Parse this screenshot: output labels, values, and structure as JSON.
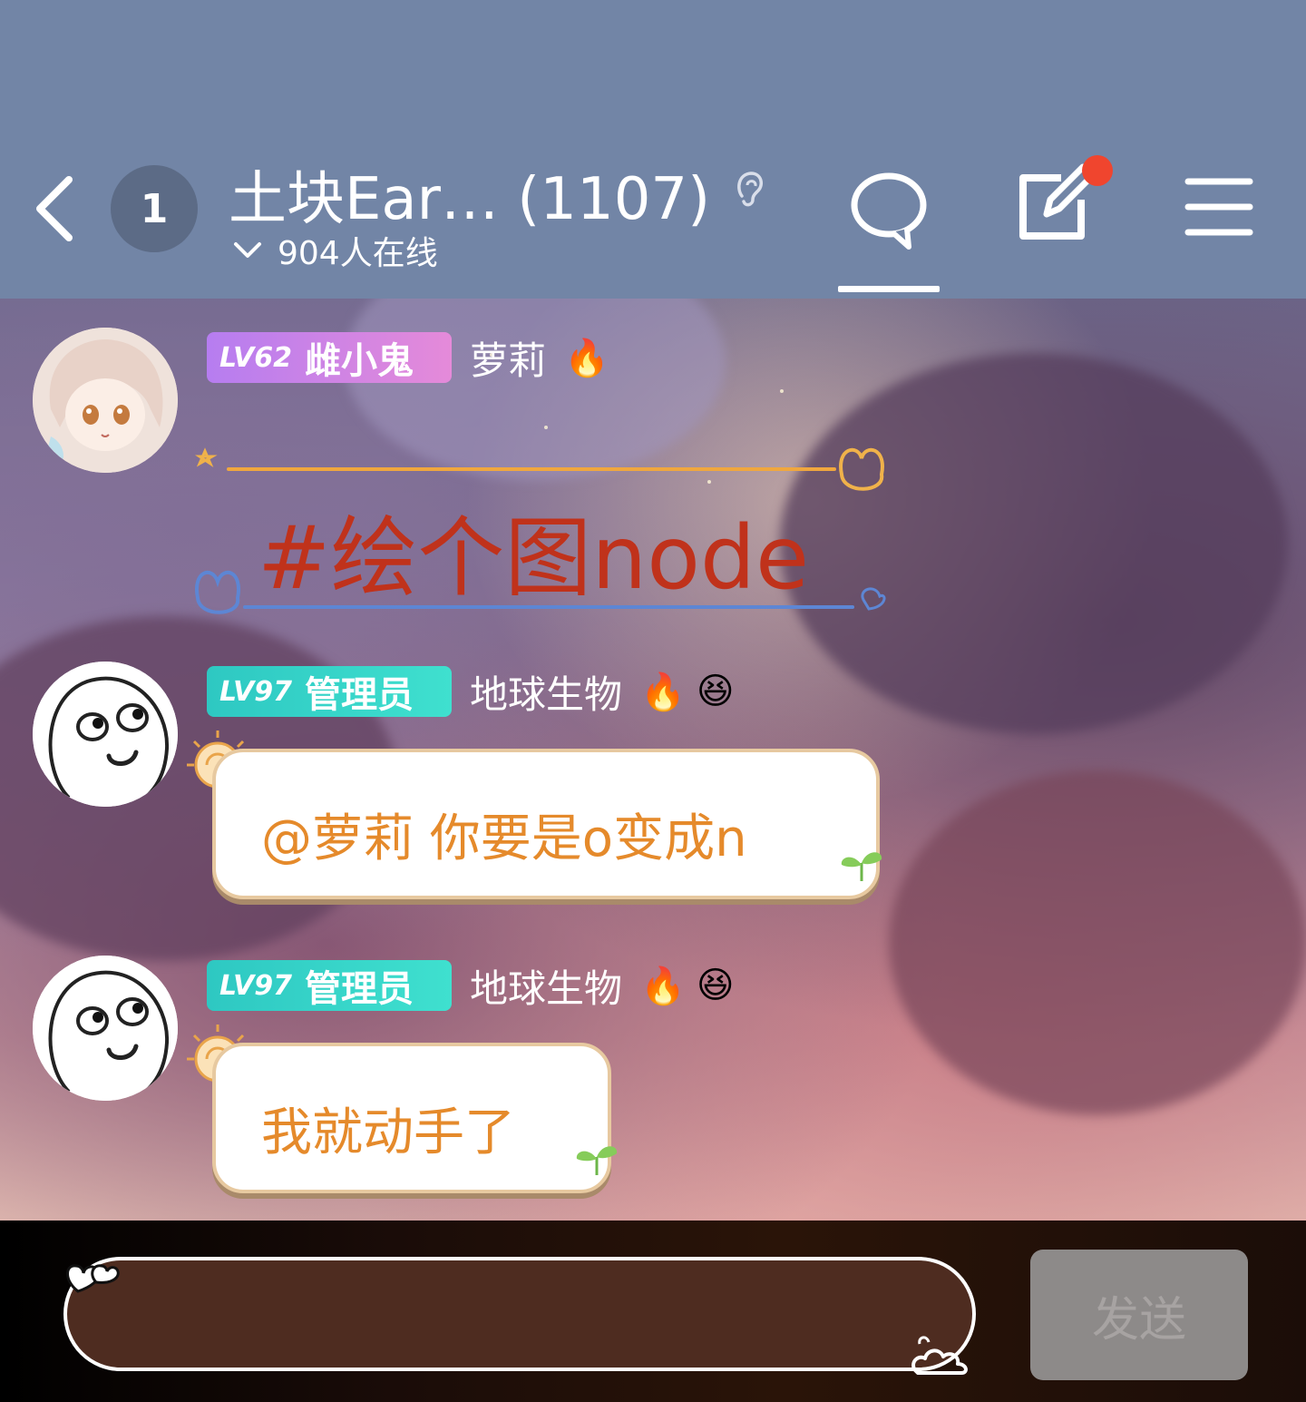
{
  "header": {
    "unread_count": "1",
    "title": "土块Ear… (1107)",
    "online": "904人在线"
  },
  "messages": [
    {
      "level": "LV62",
      "title": "雌小鬼",
      "username": "萝莉",
      "emojis": [
        "🔥"
      ],
      "text": "#绘个图node"
    },
    {
      "level": "LV97",
      "title": "管理员",
      "username": "地球生物",
      "emojis": [
        "🔥",
        "😆"
      ],
      "text": "@萝莉 你要是o变成n"
    },
    {
      "level": "LV97",
      "title": "管理员",
      "username": "地球生物",
      "emojis": [
        "🔥",
        "😆"
      ],
      "text": "我就动手了"
    }
  ],
  "composer": {
    "send_label": "发送"
  },
  "colors": {
    "header_bg": "#7285a6",
    "accent_text": "#e58a2b",
    "red_text": "#c0321b",
    "badge_teal": "#2ec8c2",
    "badge_purple": "#b67df0"
  }
}
